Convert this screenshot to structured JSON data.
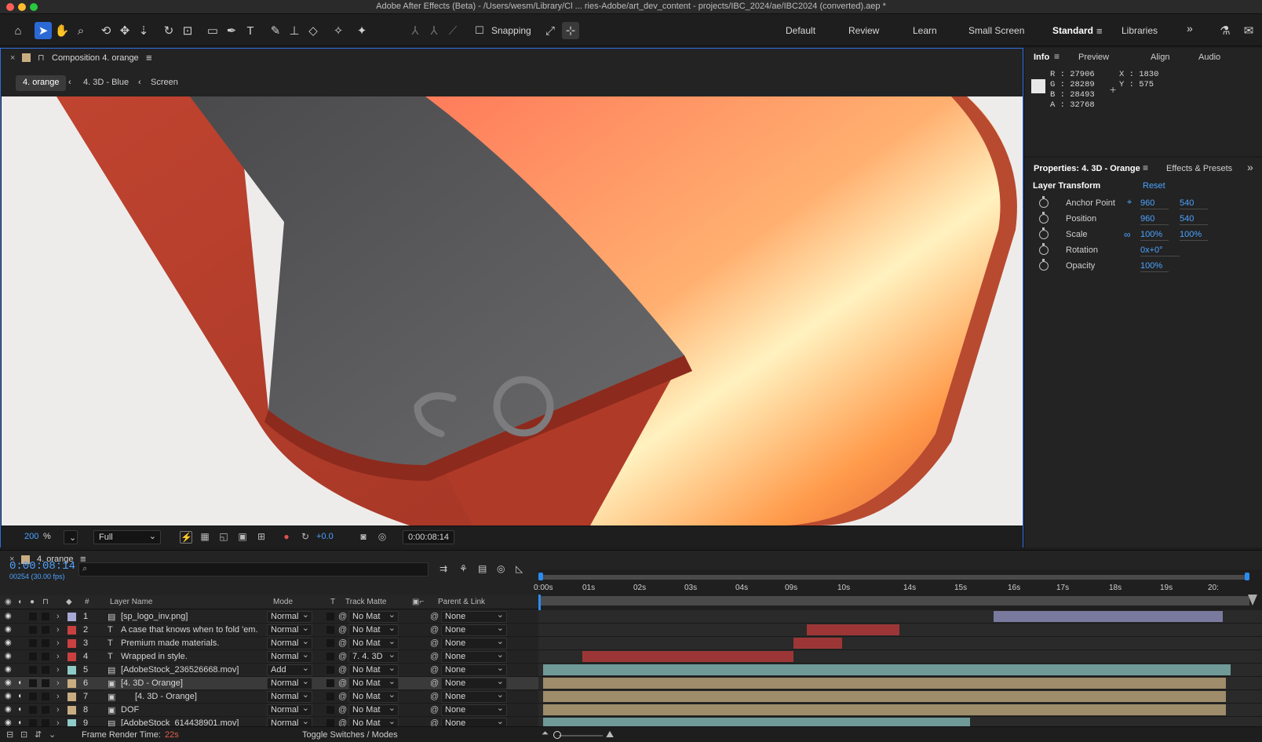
{
  "window": {
    "title": "Adobe After Effects (Beta) - /Users/wesm/Library/Cl ... ries-Adobe/art_dev_content - projects/IBC_2024/ae/IBC2024 (converted).aep *"
  },
  "toolbar": {
    "snapping_label": "Snapping",
    "workspaces": [
      "Default",
      "Review",
      "Learn",
      "Small Screen",
      "Standard",
      "Libraries"
    ],
    "active_workspace": "Standard"
  },
  "composition": {
    "panel_title": "Composition 4. orange",
    "breadcrumbs": [
      "4. orange",
      "4. 3D - Blue",
      "Screen"
    ],
    "zoom_value": "200",
    "zoom_unit": "%",
    "resolution": "Full",
    "exposure": "+0.0",
    "timecode": "0:00:08:14"
  },
  "info": {
    "tabs": [
      "Info",
      "Preview",
      "Align",
      "Audio"
    ],
    "r": "R : 27906",
    "g": "G : 28289",
    "b": "B : 28493",
    "a": "A : 32768",
    "x": "X : 1830",
    "y": "Y : 575"
  },
  "properties": {
    "tab_title": "Properties: 4. 3D - Orange",
    "tab2": "Effects & Presets",
    "section": "Layer Transform",
    "reset": "Reset",
    "rows": [
      {
        "name": "Anchor Point",
        "v1": "960",
        "v2": "540"
      },
      {
        "name": "Position",
        "v1": "960",
        "v2": "540"
      },
      {
        "name": "Scale",
        "v1": "100%",
        "v2": "100%"
      },
      {
        "name": "Rotation",
        "v1": "0x+0°",
        "v2": ""
      },
      {
        "name": "Opacity",
        "v1": "100%",
        "v2": ""
      }
    ]
  },
  "timeline": {
    "tab_title": "4. orange",
    "timecode": "0:00:08:14",
    "frame_info": "00254 (30.00 fps)",
    "search_placeholder": "",
    "columns": {
      "num": "#",
      "name": "Layer Name",
      "mode": "Mode",
      "t": "T",
      "matte": "Track Matte",
      "parent": "Parent & Link"
    },
    "ruler": [
      "0:00s",
      "01s",
      "02s",
      "03s",
      "04s",
      "09s",
      "10s",
      "14s",
      "15s",
      "16s",
      "17s",
      "18s",
      "19s",
      "20:"
    ],
    "layers": [
      {
        "num": "1",
        "type": "img",
        "label_color": "#a9a9d6",
        "name": "[sp_logo_inv.png]",
        "mode": "Normal",
        "matte": "No Mat",
        "parent": "None",
        "bar_color": "#7a7a9e"
      },
      {
        "num": "2",
        "type": "T",
        "label_color": "#c94040",
        "name": "A case that knows when to fold 'em.",
        "mode": "Normal",
        "matte": "No Mat",
        "parent": "None",
        "bar_color": "#9c3636"
      },
      {
        "num": "3",
        "type": "T",
        "label_color": "#c94040",
        "name": "Premium made materials.",
        "mode": "Normal",
        "matte": "No Mat",
        "parent": "None",
        "bar_color": "#9c3636"
      },
      {
        "num": "4",
        "type": "T",
        "label_color": "#c94040",
        "name": "Wrapped in style.",
        "mode": "Normal",
        "matte": "7. 4. 3D",
        "parent": "None",
        "bar_color": "#9c3636"
      },
      {
        "num": "5",
        "type": "img",
        "label_color": "#8ecac6",
        "name": "[AdobeStock_236526668.mov]",
        "mode": "Add",
        "matte": "No Mat",
        "parent": "None",
        "bar_color": "#6f9a98"
      },
      {
        "num": "6",
        "type": "comp",
        "label_color": "#c9ad82",
        "name": "[4. 3D - Orange]",
        "mode": "Normal",
        "matte": "No Mat",
        "parent": "None",
        "bar_color": "#9e8c6a"
      },
      {
        "num": "7",
        "type": "comp",
        "label_color": "#c9ad82",
        "name": "[4. 3D - Orange]",
        "mode": "Normal",
        "matte": "No Mat",
        "parent": "None",
        "bar_color": "#9e8c6a"
      },
      {
        "num": "8",
        "type": "comp",
        "label_color": "#c9ad82",
        "name": "DOF",
        "mode": "Normal",
        "matte": "No Mat",
        "parent": "None",
        "bar_color": "#9e8c6a"
      },
      {
        "num": "9",
        "type": "img",
        "label_color": "#8ecac6",
        "name": "[AdobeStock_614438901.mov]",
        "mode": "Normal",
        "matte": "No Mat",
        "parent": "None",
        "bar_color": "#6f9a98"
      }
    ],
    "render_label": "Frame Render Time:",
    "render_value": "22s",
    "toggle_label": "Toggle Switches / Modes"
  }
}
